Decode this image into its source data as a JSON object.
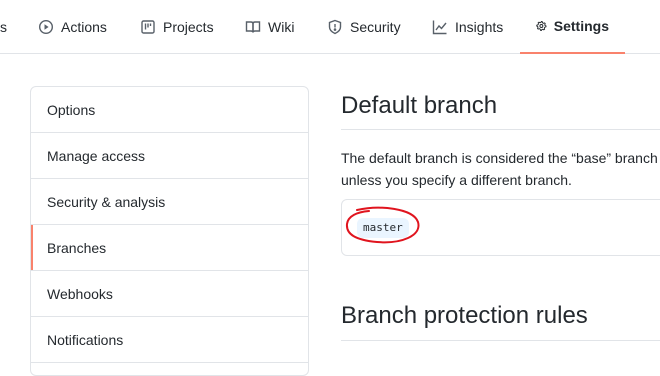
{
  "tabs": [
    {
      "label": "s",
      "icon": "partial-icon"
    },
    {
      "label": "Actions",
      "icon": "play-icon"
    },
    {
      "label": "Projects",
      "icon": "project-icon"
    },
    {
      "label": "Wiki",
      "icon": "book-icon"
    },
    {
      "label": "Security",
      "icon": "shield-icon"
    },
    {
      "label": "Insights",
      "icon": "graph-icon"
    },
    {
      "label": "Settings",
      "icon": "gear-icon",
      "active": true
    }
  ],
  "menu": {
    "items": [
      {
        "label": "Options"
      },
      {
        "label": "Manage access"
      },
      {
        "label": "Security & analysis"
      },
      {
        "label": "Branches",
        "active": true
      },
      {
        "label": "Webhooks"
      },
      {
        "label": "Notifications"
      }
    ]
  },
  "main": {
    "default_branch_title": "Default branch",
    "description_line1": "The default branch is considered the “base” branch",
    "description_line2": "unless you specify a different branch.",
    "branch_name": "master",
    "protection_title": "Branch protection rules"
  },
  "colors": {
    "active_tab_underline": "#f9826c",
    "annotation_circle": "#e0141e",
    "branch_pill_bg": "#eaf5ff"
  }
}
